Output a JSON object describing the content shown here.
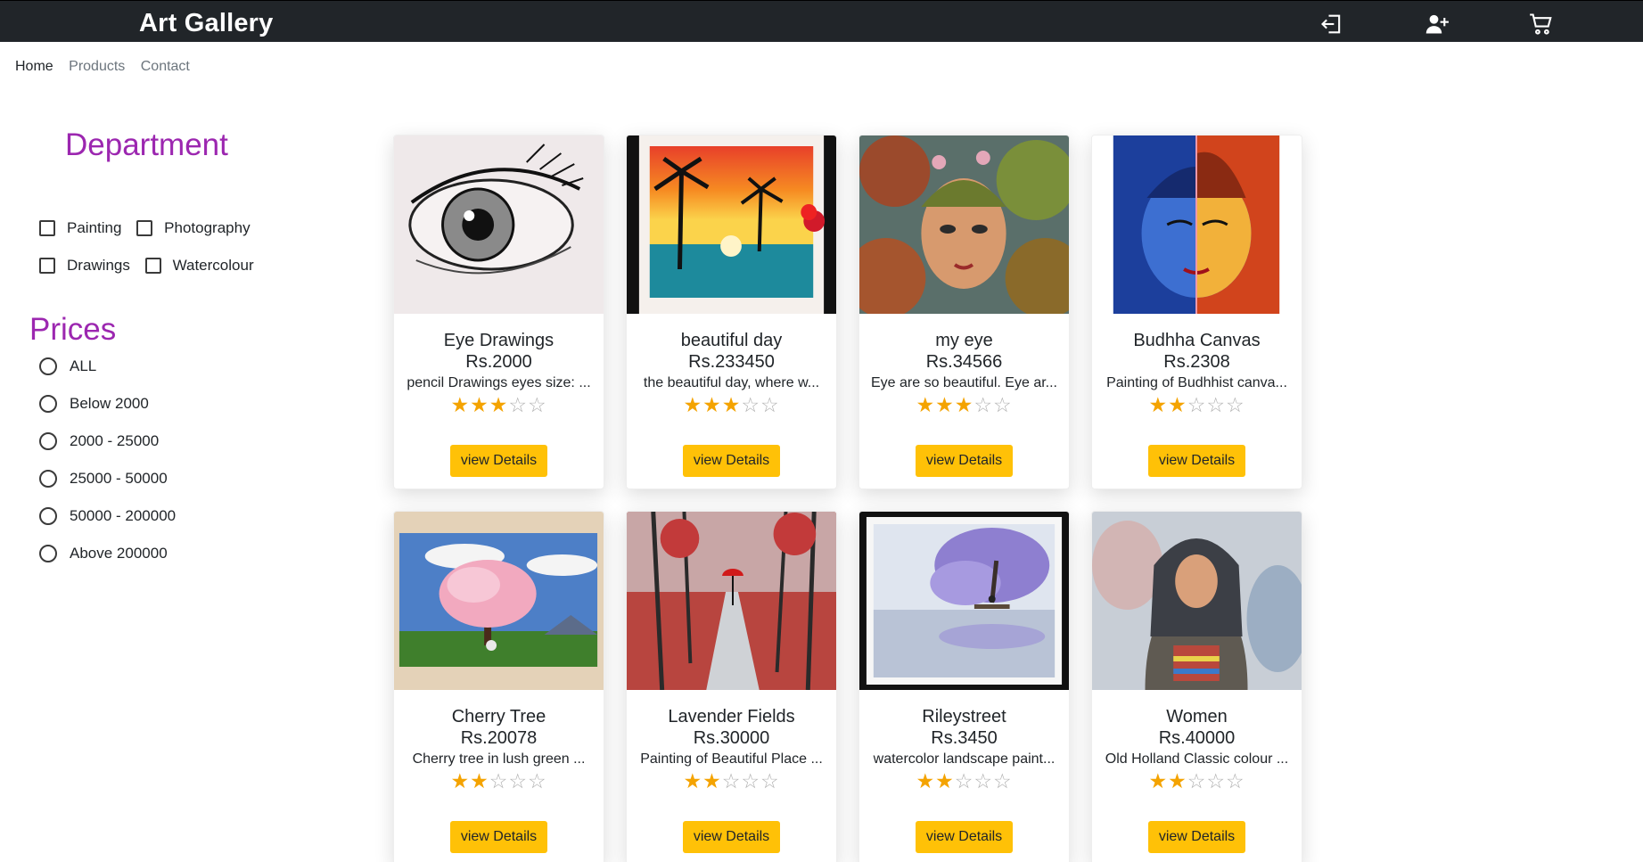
{
  "header": {
    "brand": "Art Gallery",
    "icons": [
      "sign-in-icon",
      "add-user-icon",
      "cart-icon"
    ]
  },
  "nav": {
    "items": [
      {
        "label": "Home",
        "active": true
      },
      {
        "label": "Products",
        "active": false
      },
      {
        "label": "Contact",
        "active": false
      }
    ]
  },
  "sidebar": {
    "department_title": "Department",
    "departments": [
      "Painting",
      "Photography",
      "Drawings",
      "Watercolour"
    ],
    "prices_title": "Prices",
    "prices": [
      "ALL",
      "Below 2000",
      "2000 - 25000",
      "25000 - 50000",
      "50000 - 200000",
      "Above 200000"
    ]
  },
  "colors": {
    "accent_purple": "#9c27b0",
    "button_yellow": "#ffc107",
    "star_gold": "#f4a300",
    "topbar": "#212529"
  },
  "products": [
    {
      "title": "Eye Drawings",
      "price": "Rs.2000",
      "desc": "pencil Drawings eyes size: ...",
      "rating": 3,
      "button": "view Details"
    },
    {
      "title": "beautiful day",
      "price": "Rs.233450",
      "desc": "the beautiful day, where w...",
      "rating": 3,
      "button": "view Details"
    },
    {
      "title": "my eye",
      "price": "Rs.34566",
      "desc": "Eye are so beautiful. Eye ar...",
      "rating": 3,
      "button": "view Details"
    },
    {
      "title": "Budhha Canvas",
      "price": "Rs.2308",
      "desc": "Painting of Budhhist canva...",
      "rating": 2,
      "button": "view Details"
    },
    {
      "title": "Cherry Tree",
      "price": "Rs.20078",
      "desc": "Cherry tree in lush green ...",
      "rating": 2,
      "button": "view Details"
    },
    {
      "title": "Lavender Fields",
      "price": "Rs.30000",
      "desc": "Painting of Beautiful Place ...",
      "rating": 2,
      "button": "view Details"
    },
    {
      "title": "Rileystreet",
      "price": "Rs.3450",
      "desc": "watercolor landscape paint...",
      "rating": 2,
      "button": "view Details"
    },
    {
      "title": "Women",
      "price": "Rs.40000",
      "desc": "Old Holland Classic colour ...",
      "rating": 2,
      "button": "view Details"
    }
  ]
}
